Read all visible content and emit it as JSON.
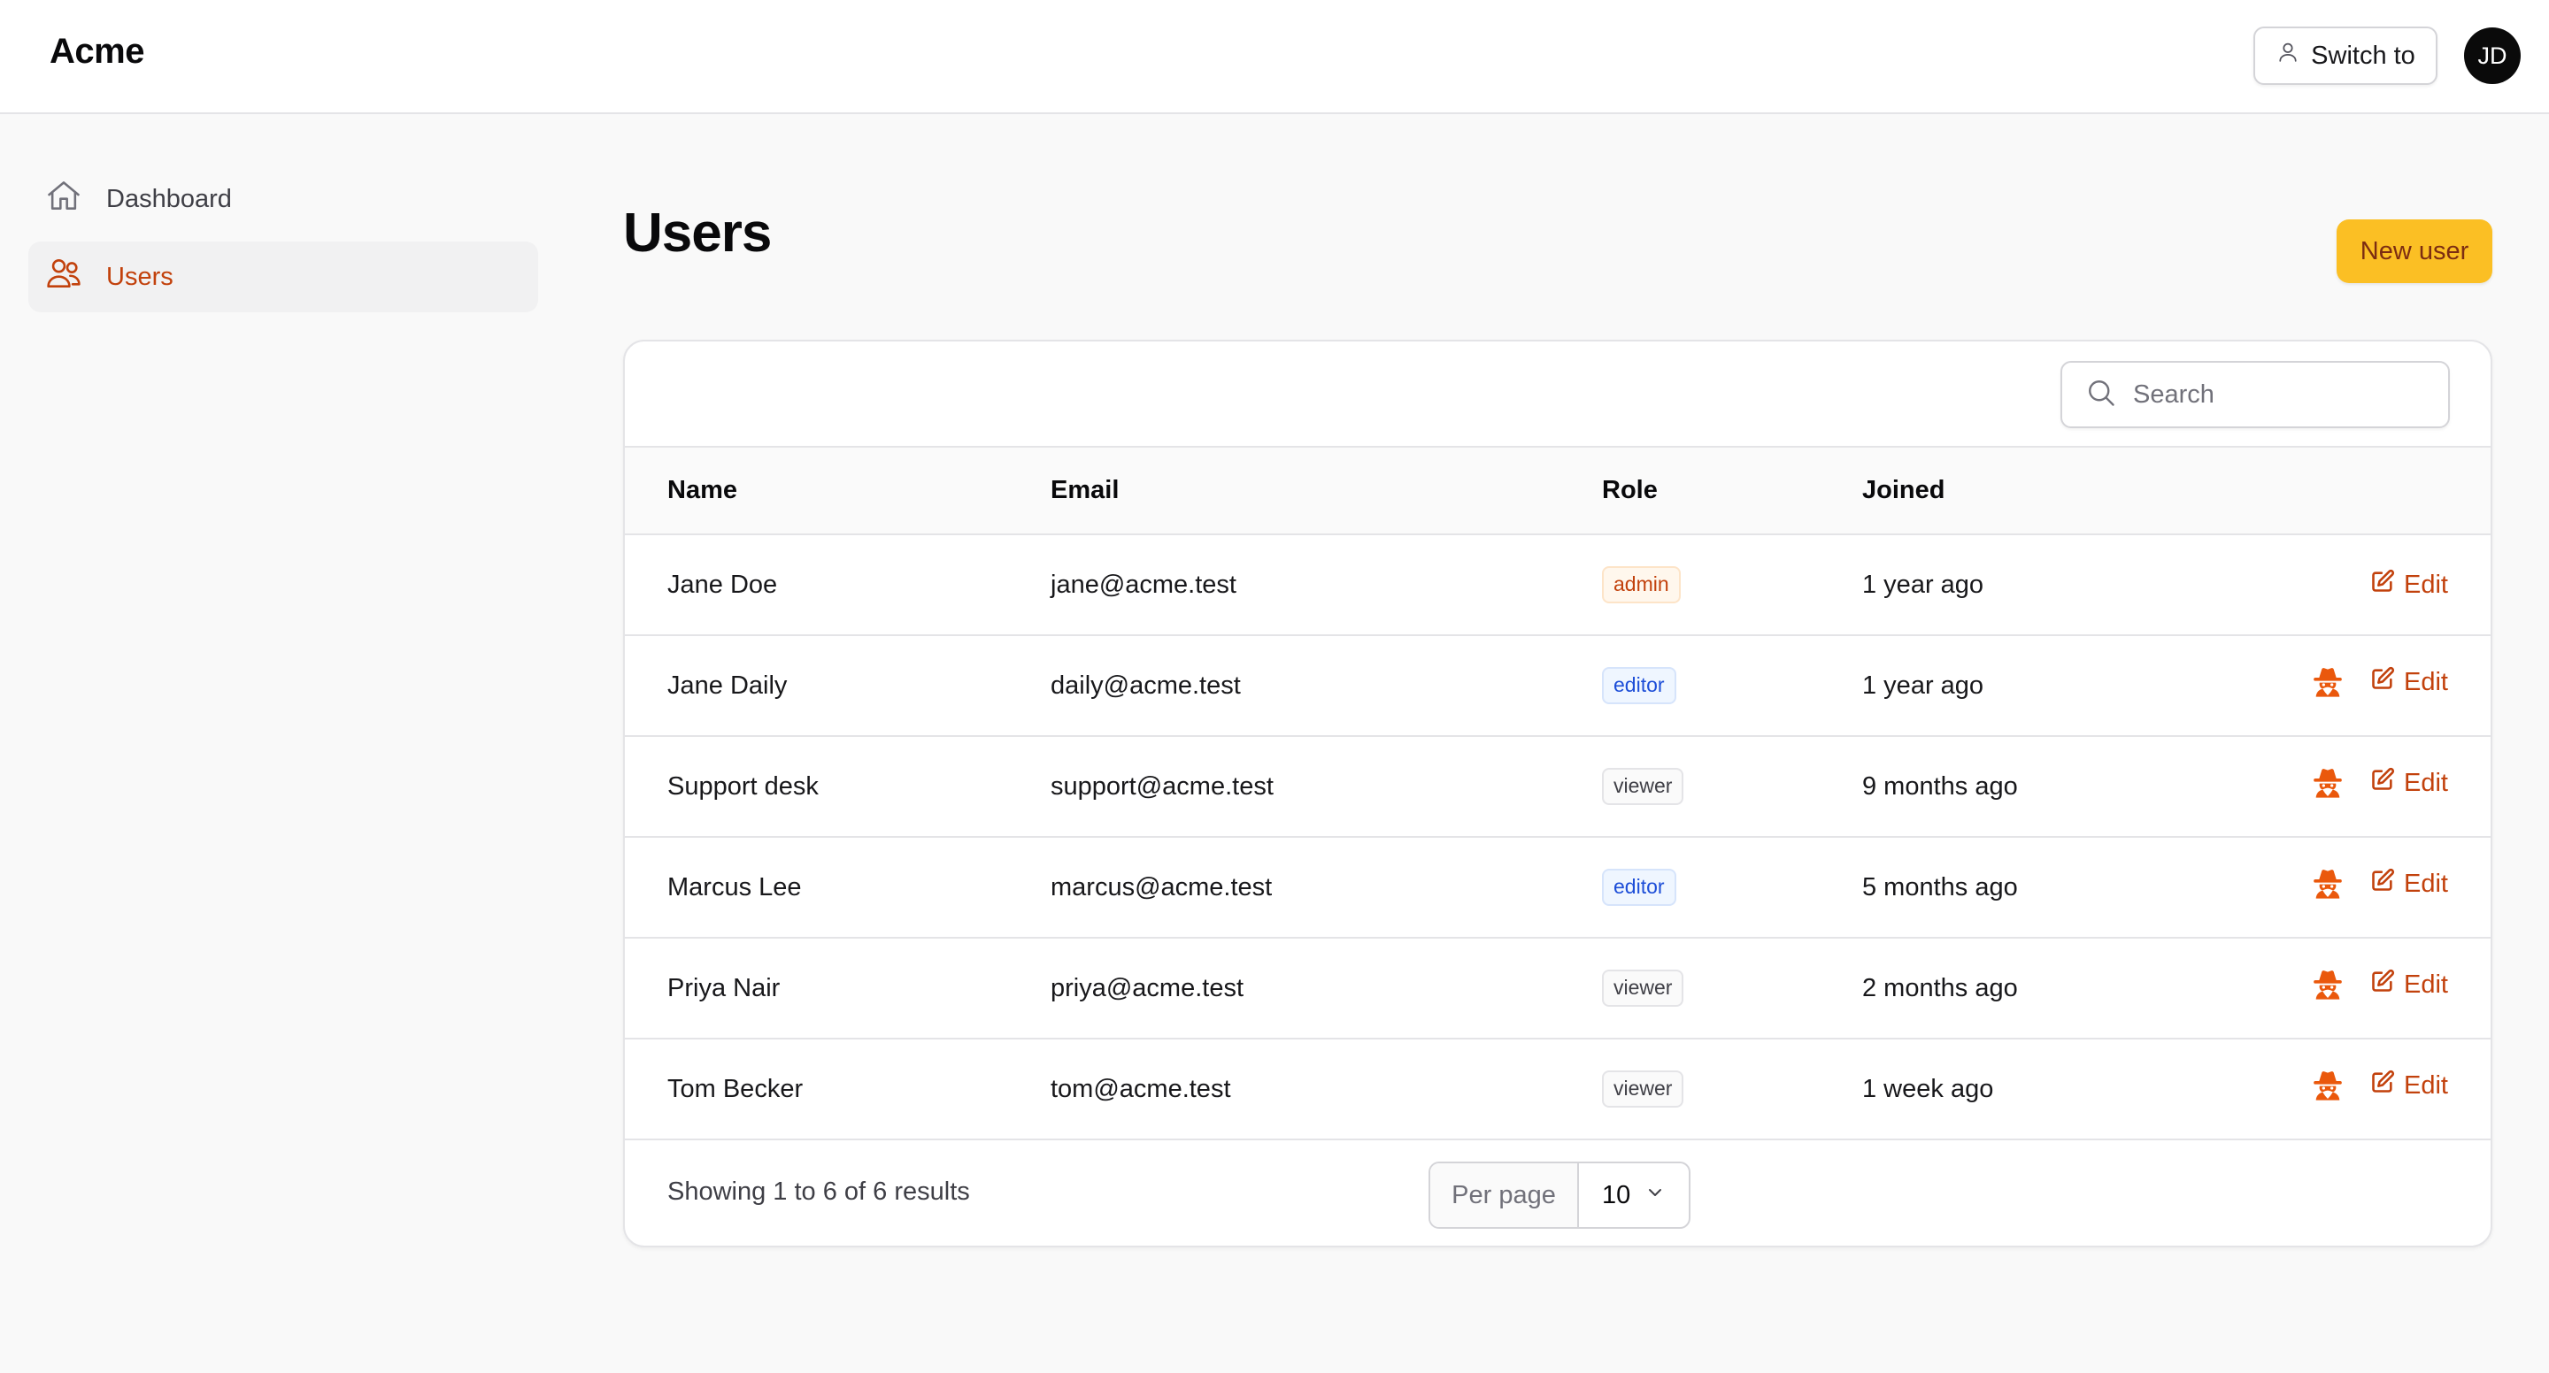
{
  "header": {
    "brand": "Acme",
    "switch_label": "Switch to",
    "avatar_initials": "JD"
  },
  "sidebar": {
    "items": [
      {
        "label": "Dashboard",
        "icon": "home-icon",
        "active": false
      },
      {
        "label": "Users",
        "icon": "users-icon",
        "active": true
      }
    ]
  },
  "page": {
    "title": "Users",
    "new_button": "New user"
  },
  "table": {
    "search_placeholder": "Search",
    "columns": [
      "Name",
      "Email",
      "Role",
      "Joined"
    ],
    "rows": [
      {
        "name": "Jane Doe",
        "email": "jane@acme.test",
        "role": "admin",
        "joined": "1 year ago",
        "edit": "Edit",
        "impersonate": false
      },
      {
        "name": "Jane Daily",
        "email": "daily@acme.test",
        "role": "editor",
        "joined": "1 year ago",
        "edit": "Edit",
        "impersonate": true
      },
      {
        "name": "Support desk",
        "email": "support@acme.test",
        "role": "viewer",
        "joined": "9 months ago",
        "edit": "Edit",
        "impersonate": true
      },
      {
        "name": "Marcus Lee",
        "email": "marcus@acme.test",
        "role": "editor",
        "joined": "5 months ago",
        "edit": "Edit",
        "impersonate": true
      },
      {
        "name": "Priya Nair",
        "email": "priya@acme.test",
        "role": "viewer",
        "joined": "2 months ago",
        "edit": "Edit",
        "impersonate": true
      },
      {
        "name": "Tom Becker",
        "email": "tom@acme.test",
        "role": "viewer",
        "joined": "1 week ago",
        "edit": "Edit",
        "impersonate": true
      }
    ]
  },
  "footer": {
    "results_text": "Showing 1 to 6 of 6 results",
    "per_page_label": "Per page",
    "per_page_value": "10"
  },
  "colors": {
    "accent": "#c2410c",
    "primary_button": "#fbbf24"
  }
}
